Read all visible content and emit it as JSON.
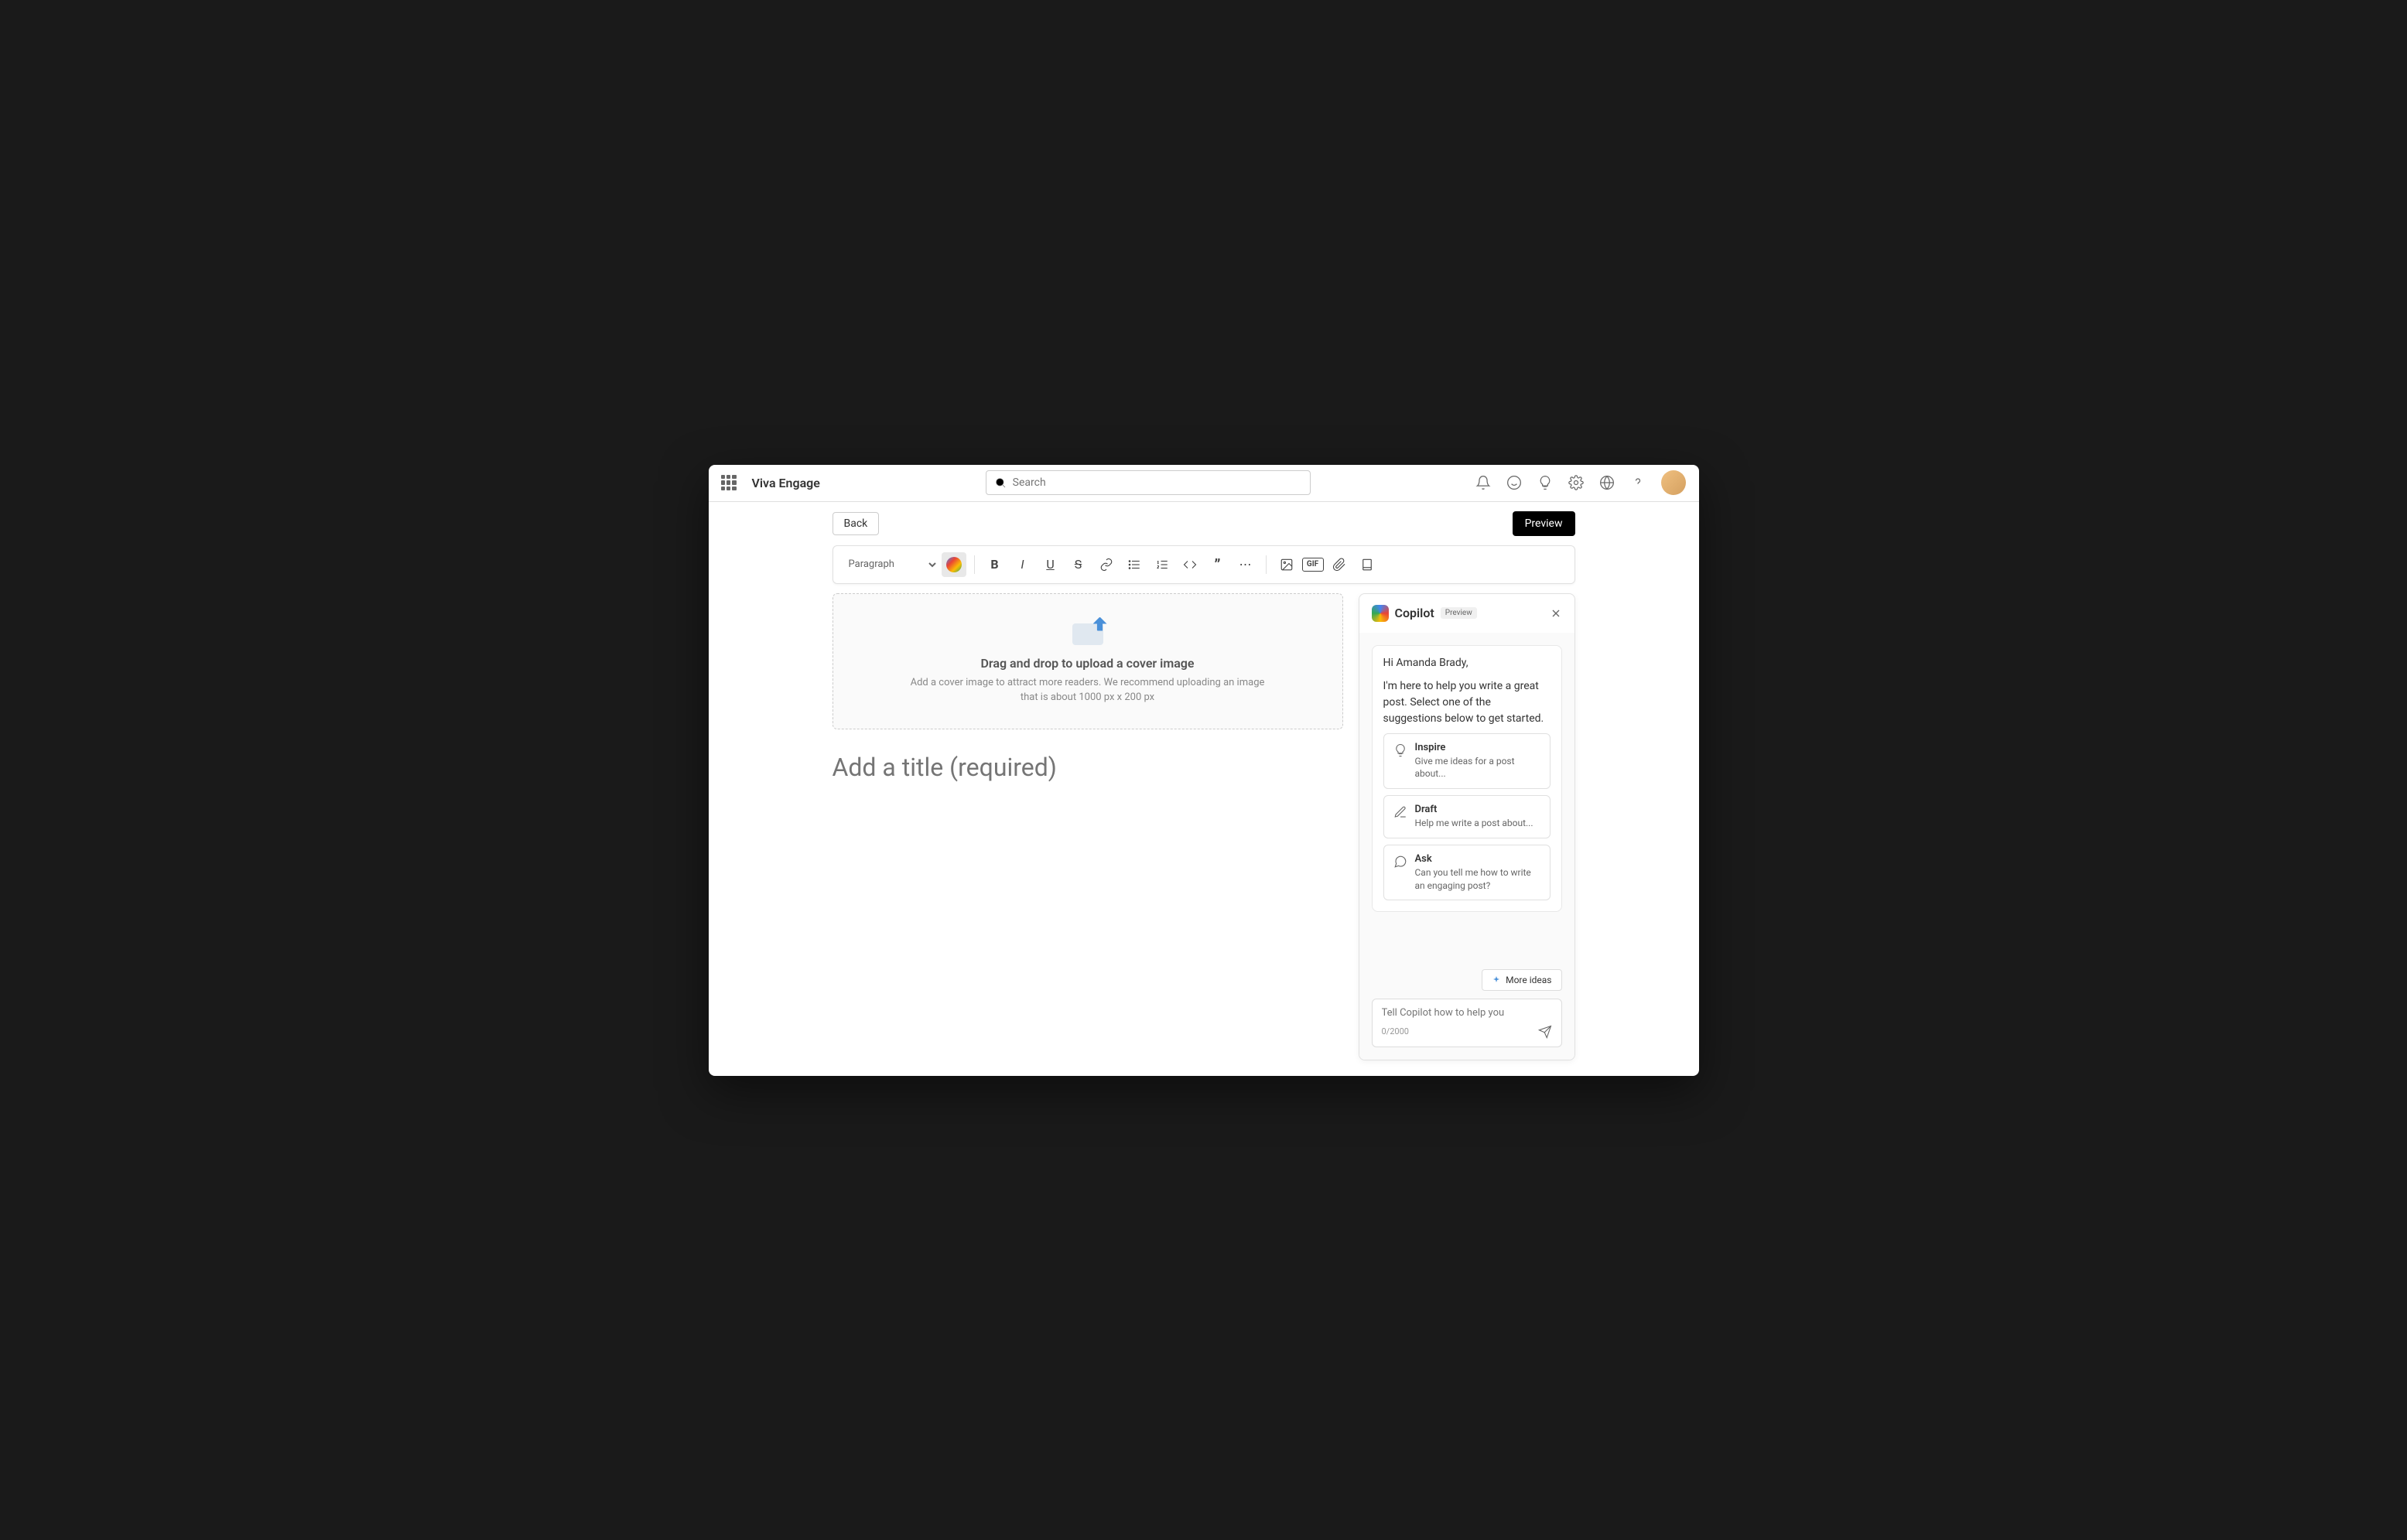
{
  "brand": "Viva Engage",
  "search": {
    "placeholder": "Search"
  },
  "subbar": {
    "back": "Back",
    "preview": "Preview"
  },
  "dropzone": {
    "title": "Drag and drop to upload a cover image",
    "sub1": "Add a cover image to attract more readers. We recommend uploading an image",
    "sub2": "that is about 1000 px x 200 px"
  },
  "title_placeholder": "Add a title (required)",
  "copilot": {
    "title": "Copilot",
    "badge": "Preview",
    "greeting": "Hi Amanda Brady,",
    "message": "I'm here to help you write a great post. Select one of the suggestions below to get started.",
    "suggestions": [
      {
        "title": "Inspire",
        "desc": "Give me ideas for a post about..."
      },
      {
        "title": "Draft",
        "desc": "Help me write a post about..."
      },
      {
        "title": "Ask",
        "desc": "Can you tell me how to write an engaging post?"
      }
    ],
    "more": "More ideas",
    "input_placeholder": "Tell Copilot how to help you",
    "count": "0/2000"
  }
}
